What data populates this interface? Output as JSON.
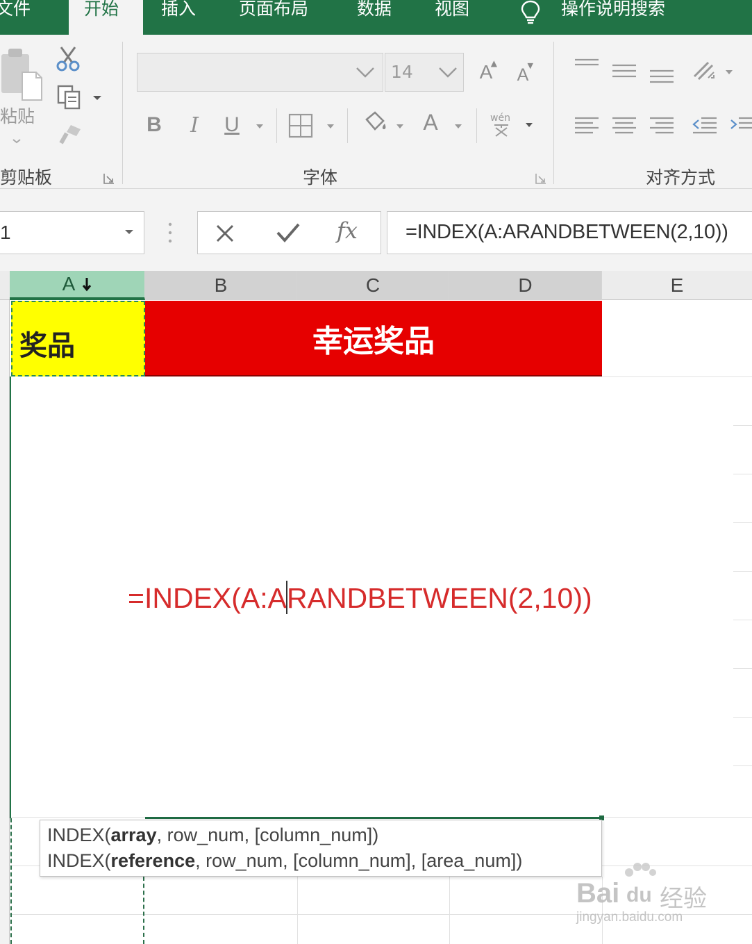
{
  "ribbon_tabs": [
    {
      "label": "文件",
      "active": false
    },
    {
      "label": "开始",
      "active": true
    },
    {
      "label": "插入",
      "active": false
    },
    {
      "label": "页面布局",
      "active": false
    },
    {
      "label": "数据",
      "active": false
    },
    {
      "label": "视图",
      "active": false
    }
  ],
  "tell_me": "操作说明搜索",
  "groups": {
    "clipboard": {
      "label": "剪贴板",
      "paste_label": "粘贴"
    },
    "font": {
      "label": "字体",
      "font_size": "14",
      "bold": "B",
      "italic": "I",
      "underline": "U",
      "grow": "A",
      "shrink": "A",
      "font_color": "A"
    },
    "alignment": {
      "label": "对齐方式"
    }
  },
  "formula_bar": {
    "name_box": "1",
    "fx": "fx",
    "formula": "=INDEX(A:ARANDBETWEEN(2,10))"
  },
  "columns": [
    "A",
    "B",
    "C",
    "D",
    "E"
  ],
  "cells": {
    "A1": "奖品",
    "B1": "幸运奖品"
  },
  "editing": {
    "before_caret": "=INDEX(A:A",
    "after_caret": "RANDBETWEEN(2,10))"
  },
  "tooltip": {
    "line1": {
      "func": "INDEX(",
      "bold": "array",
      "rest": ", row_num, [column_num])"
    },
    "line2": {
      "func": "INDEX(",
      "bold": "reference",
      "rest": ", row_num, [column_num], [area_num])"
    }
  },
  "watermark": {
    "brand": "Bai",
    "brand2": "du",
    "brand3": "经验",
    "url": "jingyan.baidu.com"
  },
  "colors": {
    "excel_green": "#217346",
    "header_red": "#e60000",
    "header_yellow": "#ffff00",
    "formula_red": "#d62b2b"
  }
}
